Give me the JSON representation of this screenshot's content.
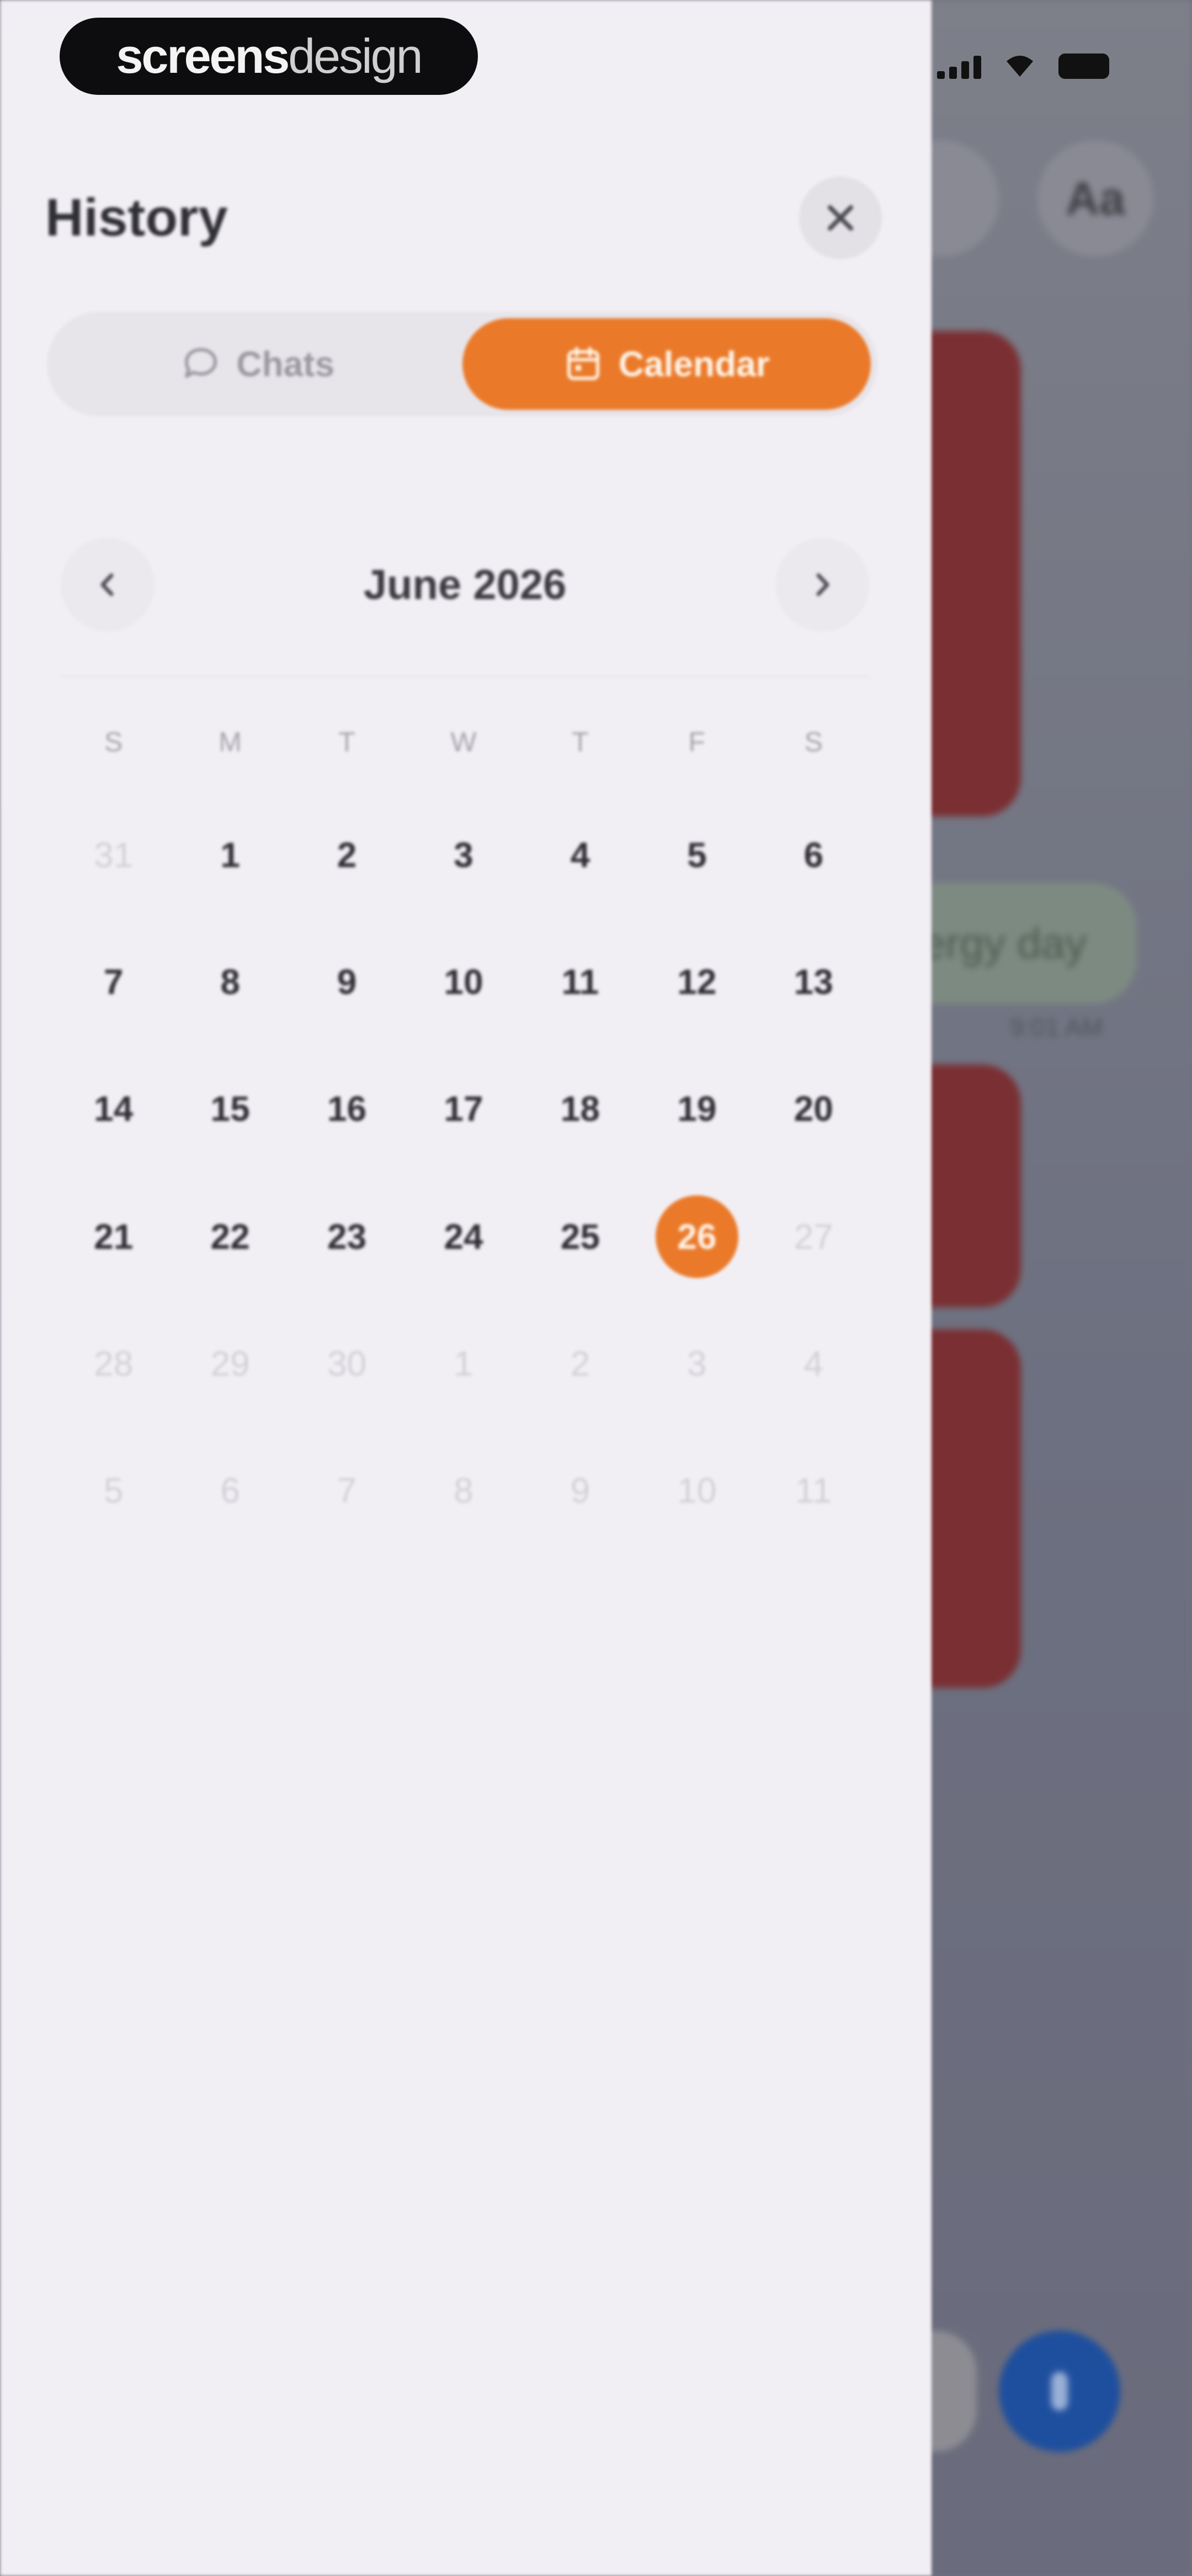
{
  "watermark": {
    "brand_bold": "screens",
    "brand_light": "design"
  },
  "background_app": {
    "font_button_label": "Aa",
    "chat_bubble_fragment": "ergy day",
    "chat_time_fragment": "9:01 AM"
  },
  "drawer": {
    "title": "History",
    "tabs": [
      {
        "label": "Chats",
        "icon": "chat-bubble-icon",
        "active": false
      },
      {
        "label": "Calendar",
        "icon": "calendar-icon",
        "active": true
      }
    ],
    "calendar": {
      "month_label": "June 2026",
      "weekdays": [
        "S",
        "M",
        "T",
        "W",
        "T",
        "F",
        "S"
      ],
      "selected_day": "26",
      "weeks": [
        [
          {
            "d": "31",
            "m": true
          },
          {
            "d": "1"
          },
          {
            "d": "2"
          },
          {
            "d": "3"
          },
          {
            "d": "4"
          },
          {
            "d": "5"
          },
          {
            "d": "6"
          }
        ],
        [
          {
            "d": "7"
          },
          {
            "d": "8"
          },
          {
            "d": "9"
          },
          {
            "d": "10"
          },
          {
            "d": "11"
          },
          {
            "d": "12"
          },
          {
            "d": "13"
          }
        ],
        [
          {
            "d": "14"
          },
          {
            "d": "15"
          },
          {
            "d": "16"
          },
          {
            "d": "17"
          },
          {
            "d": "18"
          },
          {
            "d": "19"
          },
          {
            "d": "20"
          }
        ],
        [
          {
            "d": "21"
          },
          {
            "d": "22"
          },
          {
            "d": "23"
          },
          {
            "d": "24"
          },
          {
            "d": "25"
          },
          {
            "d": "26",
            "s": true
          },
          {
            "d": "27",
            "m": true
          }
        ],
        [
          {
            "d": "28",
            "m": true
          },
          {
            "d": "29",
            "m": true
          },
          {
            "d": "30",
            "m": true
          },
          {
            "d": "1",
            "m": true
          },
          {
            "d": "2",
            "m": true
          },
          {
            "d": "3",
            "m": true
          },
          {
            "d": "4",
            "m": true
          }
        ],
        [
          {
            "d": "5",
            "m": true
          },
          {
            "d": "6",
            "m": true
          },
          {
            "d": "7",
            "m": true
          },
          {
            "d": "8",
            "m": true
          },
          {
            "d": "9",
            "m": true
          },
          {
            "d": "10",
            "m": true
          },
          {
            "d": "11",
            "m": true
          }
        ]
      ]
    }
  },
  "colors": {
    "accent": "#ea7a2a",
    "drawer_bg": "#f2eff4",
    "card_red": "#7a2f32",
    "send_blue": "#1e4f9e"
  }
}
